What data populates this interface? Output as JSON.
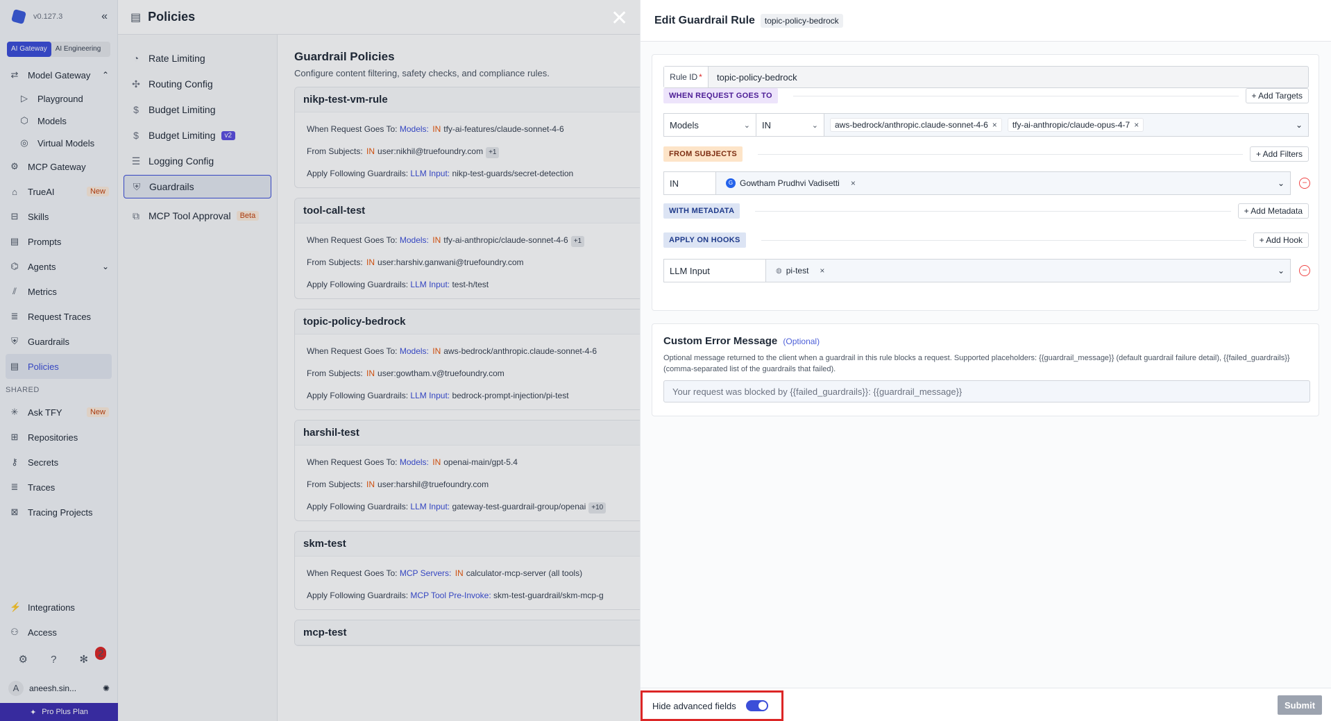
{
  "sidebar": {
    "version": "v0.127.3",
    "collapse_icon": "chevron-double-left-icon",
    "segments": [
      "AI Gateway",
      "AI Engineering"
    ],
    "items": [
      {
        "label": "Model Gateway",
        "icon": "⇄"
      },
      {
        "label": "Playground",
        "icon": "▷"
      },
      {
        "label": "Models",
        "icon": "⬡"
      },
      {
        "label": "Virtual Models",
        "icon": "◎"
      },
      {
        "label": "MCP Gateway",
        "icon": "⚙"
      },
      {
        "label": "TrueAI",
        "icon": "⌂",
        "badge": "New"
      },
      {
        "label": "Skills",
        "icon": "⊟"
      },
      {
        "label": "Prompts",
        "icon": "▤"
      },
      {
        "label": "Agents",
        "icon": "⌬"
      },
      {
        "label": "Metrics",
        "icon": "⫽"
      },
      {
        "label": "Request Traces",
        "icon": "≣"
      },
      {
        "label": "Guardrails",
        "icon": "⛨"
      },
      {
        "label": "Policies",
        "icon": "▤"
      }
    ],
    "shared_label": "SHARED",
    "shared_items": [
      {
        "label": "Ask TFY",
        "icon": "✳",
        "badge": "New"
      },
      {
        "label": "Repositories",
        "icon": "⊞"
      },
      {
        "label": "Secrets",
        "icon": "⚷"
      },
      {
        "label": "Traces",
        "icon": "≣"
      },
      {
        "label": "Tracing Projects",
        "icon": "⊠"
      }
    ],
    "bottom_items": [
      {
        "label": "Integrations",
        "icon": "⚡"
      },
      {
        "label": "Access",
        "icon": "⚇"
      }
    ],
    "notification_count": "2",
    "user_initial": "A",
    "user_name": "aneesh.sin...",
    "plan": "Pro Plus Plan"
  },
  "policies": {
    "header_title": "Policies",
    "subnav": [
      {
        "label": "Rate Limiting",
        "icon": "◔"
      },
      {
        "label": "Routing Config",
        "icon": "✣"
      },
      {
        "label": "Budget Limiting",
        "icon": "$"
      },
      {
        "label": "Budget Limiting",
        "icon": "$",
        "tag": "v2"
      },
      {
        "label": "Logging Config",
        "icon": "☰"
      },
      {
        "label": "Guardrails",
        "icon": "⛨"
      },
      {
        "label": "MCP Tool Approval",
        "icon": "⧉",
        "tag": "Beta"
      }
    ]
  },
  "guardrail_list": {
    "title": "Guardrail Policies",
    "subtitle": "Configure content filtering, safety checks, and compliance rules.",
    "labels": {
      "goes_to": "When Request Goes To:",
      "from": "From Subjects:",
      "apply": "Apply Following Guardrails:",
      "in": "IN"
    },
    "cards": [
      {
        "name": "nikp-test-vm-rule",
        "target_kind": "Models:",
        "target": "tfy-ai-features/claude-sonnet-4-6",
        "target_more": "",
        "subject": "user:nikhil@truefoundry.com",
        "subject_more": "+1",
        "hook": "LLM Input:",
        "guardrail": "nikp-test-guards/secret-detection",
        "guardrail_more": ""
      },
      {
        "name": "tool-call-test",
        "target_kind": "Models:",
        "target": "tfy-ai-anthropic/claude-sonnet-4-6",
        "target_more": "+1",
        "subject": "user:harshiv.ganwani@truefoundry.com",
        "subject_more": "",
        "hook": "LLM Input:",
        "guardrail": "test-h/test",
        "guardrail_more": ""
      },
      {
        "name": "topic-policy-bedrock",
        "target_kind": "Models:",
        "target": "aws-bedrock/anthropic.claude-sonnet-4-6",
        "target_more": "",
        "subject": "user:gowtham.v@truefoundry.com",
        "subject_more": "",
        "hook": "LLM Input:",
        "guardrail": "bedrock-prompt-injection/pi-test",
        "guardrail_more": ""
      },
      {
        "name": "harshil-test",
        "target_kind": "Models:",
        "target": "openai-main/gpt-5.4",
        "target_more": "",
        "subject": "user:harshil@truefoundry.com",
        "subject_more": "",
        "hook": "LLM Input:",
        "guardrail": "gateway-test-guardrail-group/openai",
        "guardrail_more": "+10"
      },
      {
        "name": "skm-test",
        "target_kind": "MCP Servers:",
        "target": "calculator-mcp-server (all tools)",
        "target_more": "",
        "subject": "",
        "subject_more": "",
        "hook": "MCP Tool Pre-Invoke:",
        "guardrail": "skm-test-guardrail/skm-mcp-g",
        "guardrail_more": ""
      },
      {
        "name": "mcp-test"
      }
    ]
  },
  "drawer": {
    "title": "Edit Guardrail Rule",
    "rule_chip": "topic-policy-bedrock",
    "close_icon": "close-icon",
    "rule_id_label": "Rule ID",
    "rule_id_required": "*",
    "rule_id_value": "topic-policy-bedrock",
    "goes_to": {
      "tag": "WHEN REQUEST GOES TO",
      "button": "+ Add Targets",
      "type": "Models",
      "operator": "IN",
      "values": [
        "aws-bedrock/anthropic.claude-sonnet-4-6",
        "tfy-ai-anthropic/claude-opus-4-7"
      ]
    },
    "subjects": {
      "tag": "FROM SUBJECTS",
      "button": "+ Add Filters",
      "operator": "IN",
      "avatar_initial": "G",
      "value": "Gowtham Prudhvi Vadisetti"
    },
    "metadata": {
      "tag": "WITH METADATA",
      "button": "+ Add Metadata"
    },
    "hooks": {
      "tag": "APPLY ON HOOKS",
      "button": "+ Add Hook",
      "hook": "LLM Input",
      "value": "pi-test"
    },
    "error_message": {
      "title": "Custom Error Message",
      "optional": "(Optional)",
      "description": "Optional message returned to the client when a guardrail in this rule blocks a request. Supported placeholders: {{guardrail_message}} (default guardrail failure detail), {{failed_guardrails}} (comma-separated list of the guardrails that failed).",
      "placeholder": "Your request was blocked by {{failed_guardrails}}: {{guardrail_message}}"
    },
    "footer": {
      "toggle_label": "Hide advanced fields",
      "toggle_on": true,
      "submit": "Submit"
    }
  },
  "colors": {
    "accent": "#3b4ed8",
    "highlight_border": "#dc2626"
  }
}
